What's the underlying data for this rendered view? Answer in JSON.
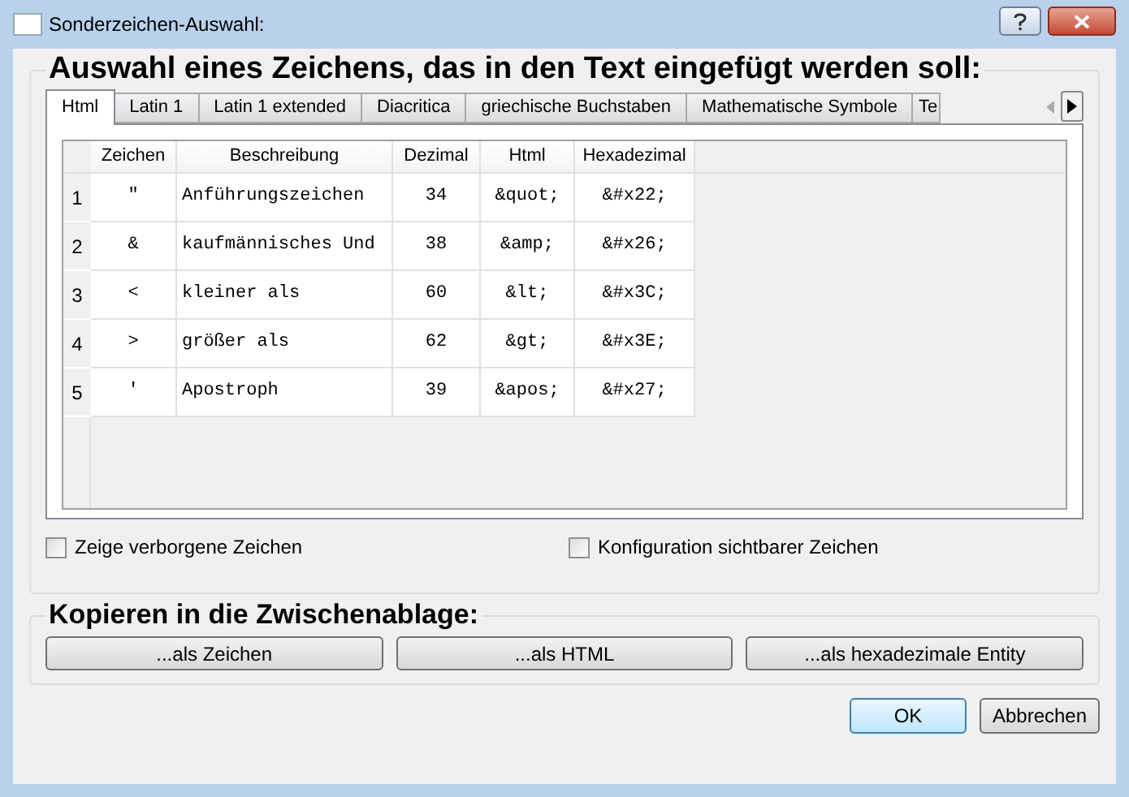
{
  "window": {
    "title": "Sonderzeichen-Auswahl:"
  },
  "heading": "Auswahl eines Zeichens, das in den Text eingefügt werden soll:",
  "tabs": [
    {
      "label": "Html",
      "selected": true
    },
    {
      "label": "Latin 1",
      "selected": false
    },
    {
      "label": "Latin 1 extended",
      "selected": false
    },
    {
      "label": "Diacritica",
      "selected": false
    },
    {
      "label": "griechische Buchstaben",
      "selected": false
    },
    {
      "label": "Mathematische Symbole",
      "selected": false
    },
    {
      "label": "Te",
      "selected": false
    }
  ],
  "table": {
    "columns": [
      "Zeichen",
      "Beschreibung",
      "Dezimal",
      "Html",
      "Hexadezimal"
    ],
    "rows": [
      {
        "number": "1",
        "cells": [
          "\"",
          "Anführungszeichen",
          "34",
          "&quot;",
          "&#x22;"
        ]
      },
      {
        "number": "2",
        "cells": [
          "&",
          "kaufmännisches Und",
          "38",
          "&amp;",
          "&#x26;"
        ]
      },
      {
        "number": "3",
        "cells": [
          "<",
          "kleiner als",
          "60",
          "&lt;",
          "&#x3C;"
        ]
      },
      {
        "number": "4",
        "cells": [
          ">",
          "größer als",
          "62",
          "&gt;",
          "&#x3E;"
        ]
      },
      {
        "number": "5",
        "cells": [
          "'",
          "Apostroph",
          "39",
          "&apos;",
          "&#x27;"
        ]
      }
    ]
  },
  "options": [
    {
      "label": "Zeige verborgene Zeichen",
      "checked": false
    },
    {
      "label": "Konfiguration sichtbarer Zeichen",
      "checked": false
    }
  ],
  "copy_heading": "Kopieren in die Zwischenablage:",
  "copy_buttons": [
    "...als Zeichen",
    "...als HTML",
    "...als hexadezimale Entity"
  ],
  "buttons": [
    {
      "label": "OK",
      "kind": "default"
    },
    {
      "label": "Abbrechen",
      "kind": "normal"
    }
  ]
}
